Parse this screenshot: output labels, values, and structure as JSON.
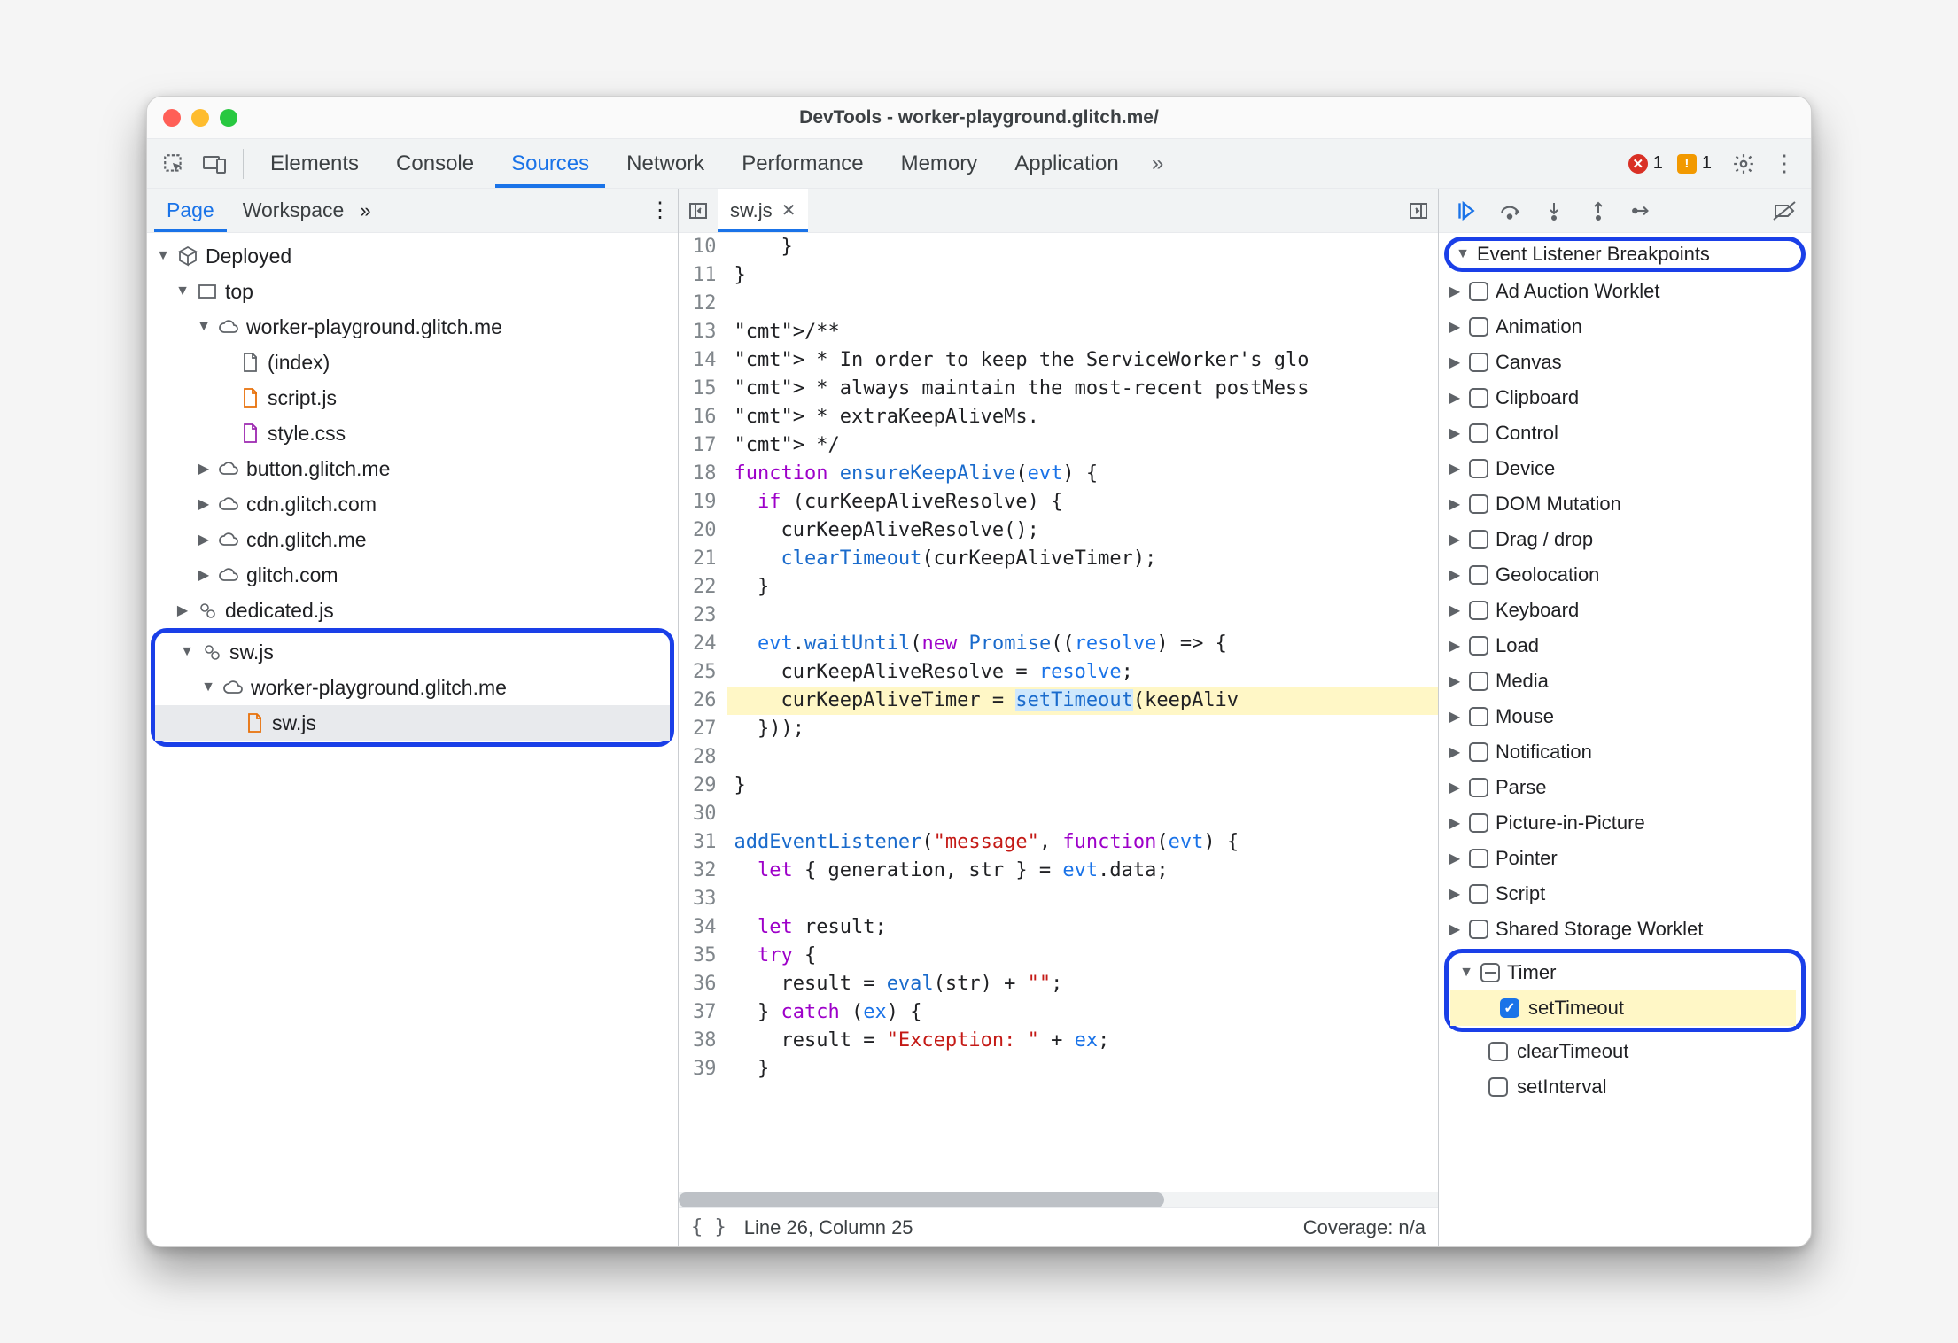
{
  "window": {
    "title": "DevTools - worker-playground.glitch.me/"
  },
  "topTabs": {
    "items": [
      "Elements",
      "Console",
      "Sources",
      "Network",
      "Performance",
      "Memory",
      "Application"
    ],
    "active": "Sources",
    "errors": {
      "count": "1"
    },
    "warnings": {
      "count": "1"
    }
  },
  "leftTabs": {
    "items": [
      "Page",
      "Workspace"
    ],
    "active": "Page"
  },
  "tree": {
    "root": "Deployed",
    "top": "top",
    "origin_main": "worker-playground.glitch.me",
    "files_main": [
      "(index)",
      "script.js",
      "style.css"
    ],
    "other_origins": [
      "button.glitch.me",
      "cdn.glitch.com",
      "cdn.glitch.me",
      "glitch.com"
    ],
    "dedicated": "dedicated.js",
    "sw_root": "sw.js",
    "sw_origin": "worker-playground.glitch.me",
    "sw_file": "sw.js"
  },
  "editor": {
    "filename": "sw.js",
    "firstLine": 10,
    "lines": [
      "    }",
      "}",
      "",
      "/**",
      " * In order to keep the ServiceWorker's glo",
      " * always maintain the most-recent postMess",
      " * extraKeepAliveMs.",
      " */",
      "function ensureKeepAlive(evt) {",
      "  if (curKeepAliveResolve) {",
      "    curKeepAliveResolve();",
      "    clearTimeout(curKeepAliveTimer);",
      "  }",
      "",
      "  evt.waitUntil(new Promise((resolve) => {",
      "    curKeepAliveResolve = resolve;",
      "    curKeepAliveTimer = setTimeout(keepAliv",
      "  }));",
      "",
      "}",
      "",
      "addEventListener(\"message\", function(evt) {",
      "  let { generation, str } = evt.data;",
      "",
      "  let result;",
      "  try {",
      "    result = eval(str) + \"\";",
      "  } catch (ex) {",
      "    result = \"Exception: \" + ex;",
      "  }"
    ],
    "highlightLine": 26,
    "highlightToken": "setTimeout"
  },
  "status": {
    "cursor": "Line 26, Column 25",
    "coverage": "Coverage: n/a"
  },
  "breakpoints": {
    "pane_title": "Event Listener Breakpoints",
    "categories": [
      "Ad Auction Worklet",
      "Animation",
      "Canvas",
      "Clipboard",
      "Control",
      "Device",
      "DOM Mutation",
      "Drag / drop",
      "Geolocation",
      "Keyboard",
      "Load",
      "Media",
      "Mouse",
      "Notification",
      "Parse",
      "Picture-in-Picture",
      "Pointer",
      "Script",
      "Shared Storage Worklet"
    ],
    "timer": {
      "label": "Timer",
      "children": [
        {
          "label": "setTimeout",
          "checked": true
        },
        {
          "label": "clearTimeout",
          "checked": false
        },
        {
          "label": "setInterval",
          "checked": false
        }
      ]
    }
  }
}
